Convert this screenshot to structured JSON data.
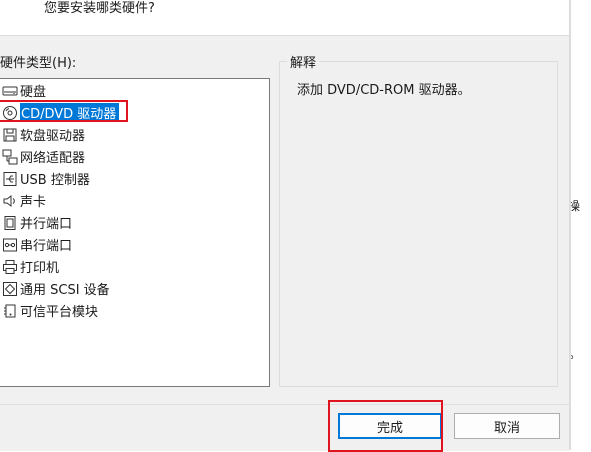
{
  "dialog": {
    "question": "您要安装哪类硬件?",
    "hardware_type_label": "硬件类型(H):",
    "hardware_items": [
      {
        "label": "硬盘",
        "icon": "hard-disk-icon"
      },
      {
        "label": "CD/DVD 驱动器",
        "icon": "cd-dvd-icon",
        "selected": true
      },
      {
        "label": "软盘驱动器",
        "icon": "floppy-icon"
      },
      {
        "label": "网络适配器",
        "icon": "network-icon"
      },
      {
        "label": "USB 控制器",
        "icon": "usb-icon"
      },
      {
        "label": "声卡",
        "icon": "sound-icon"
      },
      {
        "label": "并行端口",
        "icon": "parallel-port-icon"
      },
      {
        "label": "串行端口",
        "icon": "serial-port-icon"
      },
      {
        "label": "打印机",
        "icon": "printer-icon"
      },
      {
        "label": "通用 SCSI 设备",
        "icon": "scsi-icon"
      },
      {
        "label": "可信平台模块",
        "icon": "tpm-icon"
      }
    ],
    "explanation_title": "解释",
    "explanation_text": "添加 DVD/CD-ROM 驱动器。",
    "finish_button": "完成",
    "cancel_button": "取消"
  },
  "background": {
    "fragment_1": "操",
    "fragment_2": "。"
  },
  "colors": {
    "selection": "#0078d7",
    "highlight_frame": "#e0141e",
    "panel_background": "#f0f0f0"
  }
}
